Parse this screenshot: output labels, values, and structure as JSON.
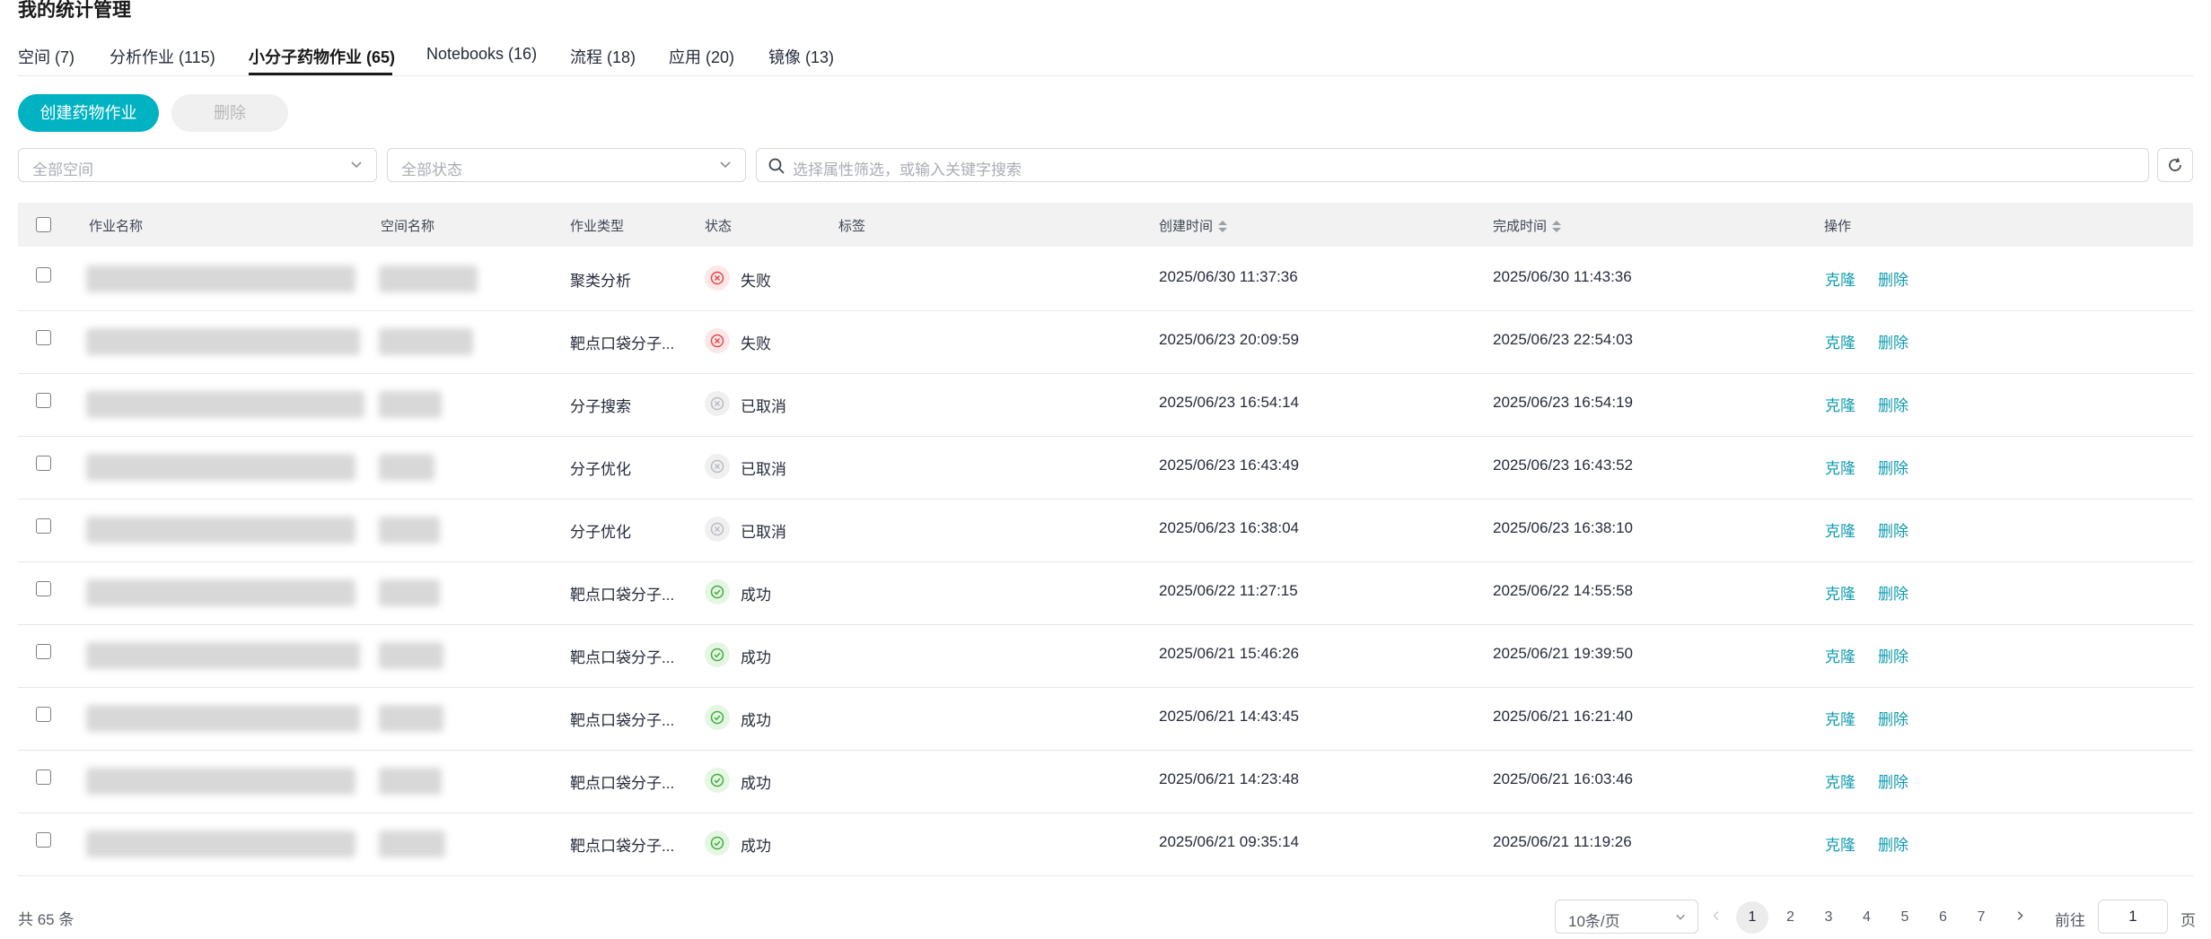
{
  "page": {
    "title": "我的统计管理"
  },
  "tabs": [
    {
      "label": "空间 (7)"
    },
    {
      "label": "分析作业 (115)"
    },
    {
      "label": "小分子药物作业 (65)",
      "active": true
    },
    {
      "label": "Notebooks (16)"
    },
    {
      "label": "流程 (18)"
    },
    {
      "label": "应用 (20)"
    },
    {
      "label": "镜像 (13)"
    }
  ],
  "toolbar": {
    "create_label": "创建药物作业",
    "delete_label": "删除"
  },
  "filters": {
    "space_placeholder": "全部空间",
    "status_placeholder": "全部状态",
    "search_placeholder": "选择属性筛选，或输入关键字搜索"
  },
  "table": {
    "headers": {
      "name": "作业名称",
      "space": "空间名称",
      "type": "作业类型",
      "status": "状态",
      "tags": "标签",
      "created": "创建时间",
      "finished": "完成时间",
      "actions": "操作"
    },
    "rows": [
      {
        "type": "聚类分析",
        "status": "失败",
        "status_kind": "failed",
        "created": "2025/06/30 11:37:36",
        "finished": "2025/06/30 11:43:36"
      },
      {
        "type": "靶点口袋分子...",
        "status": "失败",
        "status_kind": "failed",
        "created": "2025/06/23 20:09:59",
        "finished": "2025/06/23 22:54:03"
      },
      {
        "type": "分子搜索",
        "status": "已取消",
        "status_kind": "cancelled",
        "created": "2025/06/23 16:54:14",
        "finished": "2025/06/23 16:54:19"
      },
      {
        "type": "分子优化",
        "status": "已取消",
        "status_kind": "cancelled",
        "created": "2025/06/23 16:43:49",
        "finished": "2025/06/23 16:43:52"
      },
      {
        "type": "分子优化",
        "status": "已取消",
        "status_kind": "cancelled",
        "created": "2025/06/23 16:38:04",
        "finished": "2025/06/23 16:38:10"
      },
      {
        "type": "靶点口袋分子...",
        "status": "成功",
        "status_kind": "success",
        "created": "2025/06/22 11:27:15",
        "finished": "2025/06/22 14:55:58"
      },
      {
        "type": "靶点口袋分子...",
        "status": "成功",
        "status_kind": "success",
        "created": "2025/06/21 15:46:26",
        "finished": "2025/06/21 19:39:50"
      },
      {
        "type": "靶点口袋分子...",
        "status": "成功",
        "status_kind": "success",
        "created": "2025/06/21 14:43:45",
        "finished": "2025/06/21 16:21:40"
      },
      {
        "type": "靶点口袋分子...",
        "status": "成功",
        "status_kind": "success",
        "created": "2025/06/21 14:23:48",
        "finished": "2025/06/21 16:03:46"
      },
      {
        "type": "靶点口袋分子...",
        "status": "成功",
        "status_kind": "success",
        "created": "2025/06/21 09:35:14",
        "finished": "2025/06/21 11:19:26"
      }
    ],
    "row_actions": {
      "clone": "克隆",
      "delete": "删除"
    }
  },
  "pagination": {
    "total_text": "共 65 条",
    "page_size": "10条/页",
    "pages": [
      "1",
      "2",
      "3",
      "4",
      "5",
      "6",
      "7"
    ],
    "current": "1",
    "goto_label": "前往",
    "goto_value": "1",
    "page_suffix": "页"
  },
  "colors": {
    "accent": "#00b2c2",
    "link": "#0f9bb0",
    "failed": "#e5484d",
    "success": "#3fae3a",
    "cancelled": "#b9bcc2"
  }
}
